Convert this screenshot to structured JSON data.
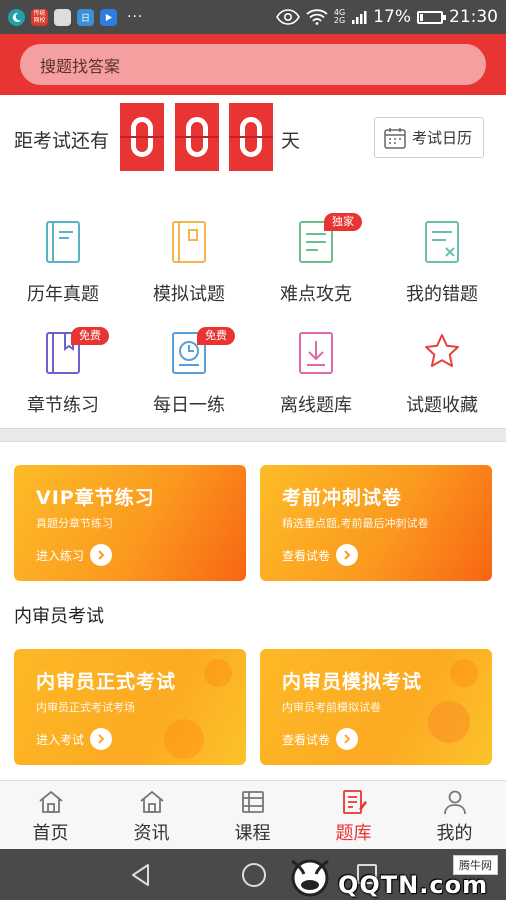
{
  "status_bar": {
    "app_icon_2_label": "传统\n网校",
    "app_icon_4_label": "日",
    "more": "···",
    "network": "4G\n2G",
    "battery": "17%",
    "battery_level": 0.17,
    "time": "21:30"
  },
  "search": {
    "placeholder": "搜题找答案"
  },
  "countdown": {
    "label": "距考试还有",
    "digits": [
      "0",
      "0",
      "0"
    ],
    "unit": "天",
    "calendar_label": "考试日历"
  },
  "grid": [
    {
      "label": "历年真题",
      "icon": "book-icon",
      "badge": ""
    },
    {
      "label": "模拟试题",
      "icon": "notebook-icon",
      "badge": ""
    },
    {
      "label": "难点攻克",
      "icon": "document-icon",
      "badge": "独家"
    },
    {
      "label": "我的错题",
      "icon": "wrong-answer-icon",
      "badge": ""
    },
    {
      "label": "章节练习",
      "icon": "chapter-book-icon",
      "badge": "免费"
    },
    {
      "label": "每日一练",
      "icon": "clock-icon",
      "badge": "免费"
    },
    {
      "label": "离线题库",
      "icon": "download-icon",
      "badge": ""
    },
    {
      "label": "试题收藏",
      "icon": "star-icon",
      "badge": ""
    }
  ],
  "cards": {
    "vip": {
      "title": "VIP章节练习",
      "subtitle": "真题分章节练习",
      "link": "进入练习"
    },
    "sprint": {
      "title": "考前冲刺试卷",
      "subtitle": "精选重点题,考前最后冲刺试卷",
      "link": "查看试卷"
    },
    "formal": {
      "title": "内审员正式考试",
      "subtitle": "内审员正式考试考场",
      "link": "进入考试"
    },
    "mock": {
      "title": "内审员模拟考试",
      "subtitle": "内审员考前模拟试卷",
      "link": "查看试卷"
    }
  },
  "section_title": "内审员考试",
  "bottom_nav": [
    {
      "label": "首页",
      "icon": "home-icon",
      "active": false
    },
    {
      "label": "资讯",
      "icon": "news-icon",
      "active": false
    },
    {
      "label": "课程",
      "icon": "course-icon",
      "active": false
    },
    {
      "label": "题库",
      "icon": "question-bank-icon",
      "active": true
    },
    {
      "label": "我的",
      "icon": "profile-icon",
      "active": false
    }
  ],
  "watermark": {
    "brand": "腾牛网",
    "domain": "QQTN.com"
  },
  "colors": {
    "accent": "#e83432",
    "card_orange": "#fb9a1f",
    "icon_teal": "#5ab3c4"
  }
}
